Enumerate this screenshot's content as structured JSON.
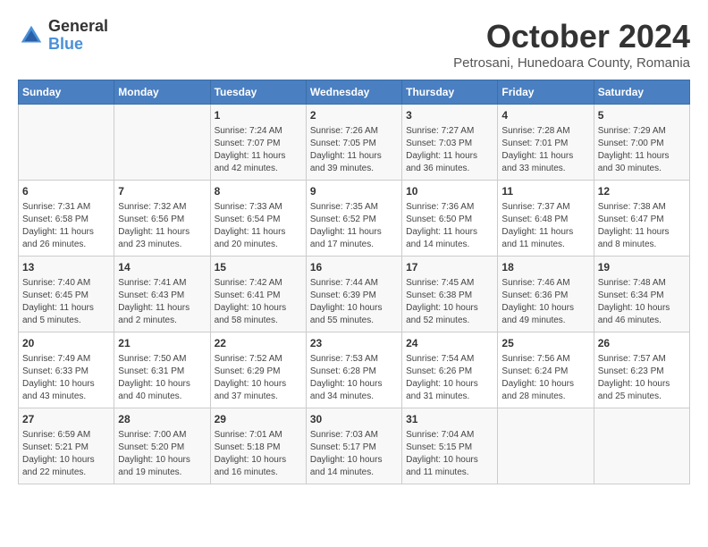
{
  "logo": {
    "line1": "General",
    "line2": "Blue"
  },
  "title": "October 2024",
  "subtitle": "Petrosani, Hunedoara County, Romania",
  "days_header": [
    "Sunday",
    "Monday",
    "Tuesday",
    "Wednesday",
    "Thursday",
    "Friday",
    "Saturday"
  ],
  "weeks": [
    [
      {
        "day": "",
        "sunrise": "",
        "sunset": "",
        "daylight": ""
      },
      {
        "day": "",
        "sunrise": "",
        "sunset": "",
        "daylight": ""
      },
      {
        "day": "1",
        "sunrise": "Sunrise: 7:24 AM",
        "sunset": "Sunset: 7:07 PM",
        "daylight": "Daylight: 11 hours and 42 minutes."
      },
      {
        "day": "2",
        "sunrise": "Sunrise: 7:26 AM",
        "sunset": "Sunset: 7:05 PM",
        "daylight": "Daylight: 11 hours and 39 minutes."
      },
      {
        "day": "3",
        "sunrise": "Sunrise: 7:27 AM",
        "sunset": "Sunset: 7:03 PM",
        "daylight": "Daylight: 11 hours and 36 minutes."
      },
      {
        "day": "4",
        "sunrise": "Sunrise: 7:28 AM",
        "sunset": "Sunset: 7:01 PM",
        "daylight": "Daylight: 11 hours and 33 minutes."
      },
      {
        "day": "5",
        "sunrise": "Sunrise: 7:29 AM",
        "sunset": "Sunset: 7:00 PM",
        "daylight": "Daylight: 11 hours and 30 minutes."
      }
    ],
    [
      {
        "day": "6",
        "sunrise": "Sunrise: 7:31 AM",
        "sunset": "Sunset: 6:58 PM",
        "daylight": "Daylight: 11 hours and 26 minutes."
      },
      {
        "day": "7",
        "sunrise": "Sunrise: 7:32 AM",
        "sunset": "Sunset: 6:56 PM",
        "daylight": "Daylight: 11 hours and 23 minutes."
      },
      {
        "day": "8",
        "sunrise": "Sunrise: 7:33 AM",
        "sunset": "Sunset: 6:54 PM",
        "daylight": "Daylight: 11 hours and 20 minutes."
      },
      {
        "day": "9",
        "sunrise": "Sunrise: 7:35 AM",
        "sunset": "Sunset: 6:52 PM",
        "daylight": "Daylight: 11 hours and 17 minutes."
      },
      {
        "day": "10",
        "sunrise": "Sunrise: 7:36 AM",
        "sunset": "Sunset: 6:50 PM",
        "daylight": "Daylight: 11 hours and 14 minutes."
      },
      {
        "day": "11",
        "sunrise": "Sunrise: 7:37 AM",
        "sunset": "Sunset: 6:48 PM",
        "daylight": "Daylight: 11 hours and 11 minutes."
      },
      {
        "day": "12",
        "sunrise": "Sunrise: 7:38 AM",
        "sunset": "Sunset: 6:47 PM",
        "daylight": "Daylight: 11 hours and 8 minutes."
      }
    ],
    [
      {
        "day": "13",
        "sunrise": "Sunrise: 7:40 AM",
        "sunset": "Sunset: 6:45 PM",
        "daylight": "Daylight: 11 hours and 5 minutes."
      },
      {
        "day": "14",
        "sunrise": "Sunrise: 7:41 AM",
        "sunset": "Sunset: 6:43 PM",
        "daylight": "Daylight: 11 hours and 2 minutes."
      },
      {
        "day": "15",
        "sunrise": "Sunrise: 7:42 AM",
        "sunset": "Sunset: 6:41 PM",
        "daylight": "Daylight: 10 hours and 58 minutes."
      },
      {
        "day": "16",
        "sunrise": "Sunrise: 7:44 AM",
        "sunset": "Sunset: 6:39 PM",
        "daylight": "Daylight: 10 hours and 55 minutes."
      },
      {
        "day": "17",
        "sunrise": "Sunrise: 7:45 AM",
        "sunset": "Sunset: 6:38 PM",
        "daylight": "Daylight: 10 hours and 52 minutes."
      },
      {
        "day": "18",
        "sunrise": "Sunrise: 7:46 AM",
        "sunset": "Sunset: 6:36 PM",
        "daylight": "Daylight: 10 hours and 49 minutes."
      },
      {
        "day": "19",
        "sunrise": "Sunrise: 7:48 AM",
        "sunset": "Sunset: 6:34 PM",
        "daylight": "Daylight: 10 hours and 46 minutes."
      }
    ],
    [
      {
        "day": "20",
        "sunrise": "Sunrise: 7:49 AM",
        "sunset": "Sunset: 6:33 PM",
        "daylight": "Daylight: 10 hours and 43 minutes."
      },
      {
        "day": "21",
        "sunrise": "Sunrise: 7:50 AM",
        "sunset": "Sunset: 6:31 PM",
        "daylight": "Daylight: 10 hours and 40 minutes."
      },
      {
        "day": "22",
        "sunrise": "Sunrise: 7:52 AM",
        "sunset": "Sunset: 6:29 PM",
        "daylight": "Daylight: 10 hours and 37 minutes."
      },
      {
        "day": "23",
        "sunrise": "Sunrise: 7:53 AM",
        "sunset": "Sunset: 6:28 PM",
        "daylight": "Daylight: 10 hours and 34 minutes."
      },
      {
        "day": "24",
        "sunrise": "Sunrise: 7:54 AM",
        "sunset": "Sunset: 6:26 PM",
        "daylight": "Daylight: 10 hours and 31 minutes."
      },
      {
        "day": "25",
        "sunrise": "Sunrise: 7:56 AM",
        "sunset": "Sunset: 6:24 PM",
        "daylight": "Daylight: 10 hours and 28 minutes."
      },
      {
        "day": "26",
        "sunrise": "Sunrise: 7:57 AM",
        "sunset": "Sunset: 6:23 PM",
        "daylight": "Daylight: 10 hours and 25 minutes."
      }
    ],
    [
      {
        "day": "27",
        "sunrise": "Sunrise: 6:59 AM",
        "sunset": "Sunset: 5:21 PM",
        "daylight": "Daylight: 10 hours and 22 minutes."
      },
      {
        "day": "28",
        "sunrise": "Sunrise: 7:00 AM",
        "sunset": "Sunset: 5:20 PM",
        "daylight": "Daylight: 10 hours and 19 minutes."
      },
      {
        "day": "29",
        "sunrise": "Sunrise: 7:01 AM",
        "sunset": "Sunset: 5:18 PM",
        "daylight": "Daylight: 10 hours and 16 minutes."
      },
      {
        "day": "30",
        "sunrise": "Sunrise: 7:03 AM",
        "sunset": "Sunset: 5:17 PM",
        "daylight": "Daylight: 10 hours and 14 minutes."
      },
      {
        "day": "31",
        "sunrise": "Sunrise: 7:04 AM",
        "sunset": "Sunset: 5:15 PM",
        "daylight": "Daylight: 10 hours and 11 minutes."
      },
      {
        "day": "",
        "sunrise": "",
        "sunset": "",
        "daylight": ""
      },
      {
        "day": "",
        "sunrise": "",
        "sunset": "",
        "daylight": ""
      }
    ]
  ]
}
